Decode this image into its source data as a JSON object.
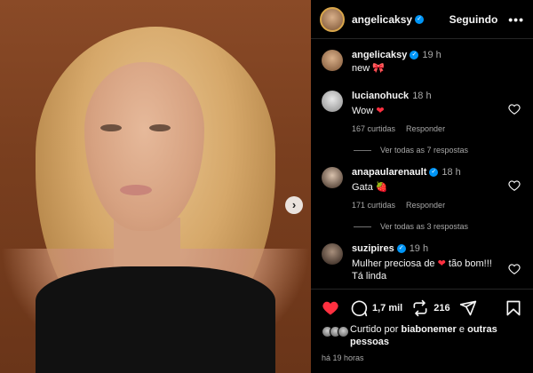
{
  "post": {
    "username": "angelicaksy",
    "follow_label": "Seguindo",
    "more_label": "•••",
    "caption_user": "angelicaksy",
    "caption_time": "19 h",
    "caption_text": "new 🎀"
  },
  "comments": [
    {
      "user": "lucianohuck",
      "time": "18 h",
      "text": "Wow",
      "emoji": "❤",
      "likes": "167 curtidas",
      "reply": "Responder",
      "replies": "Ver todas as 7 respostas"
    },
    {
      "user": "anapaularenault",
      "time": "18 h",
      "text": "Gata",
      "emoji": "🍓",
      "likes": "171 curtidas",
      "reply": "Responder",
      "replies": "Ver todas as 3 respostas"
    },
    {
      "user": "suzipires",
      "time": "19 h",
      "text_before": "Mulher preciosa de",
      "emoji": "❤",
      "text_after": "tão bom!!!",
      "text_line2": "Tá linda"
    }
  ],
  "actions": {
    "comments_count": "1,7 mil",
    "shares_count": "216",
    "liked_prefix": "Curtido por",
    "liked_user": "biabonemer",
    "liked_conj": "e",
    "liked_others": "outras pessoas",
    "timestamp": "há 19 horas"
  },
  "colors": {
    "accent_like": "#ff3040",
    "verified": "#0095f6",
    "panel_bg": "#000000",
    "muted_text": "#a8a8a8"
  },
  "icons": {
    "next": "chevron-right-icon",
    "like": "heart-filled-icon",
    "comment": "comment-bubble-icon",
    "repost": "repost-icon",
    "share": "paper-plane-icon",
    "save": "bookmark-icon"
  }
}
